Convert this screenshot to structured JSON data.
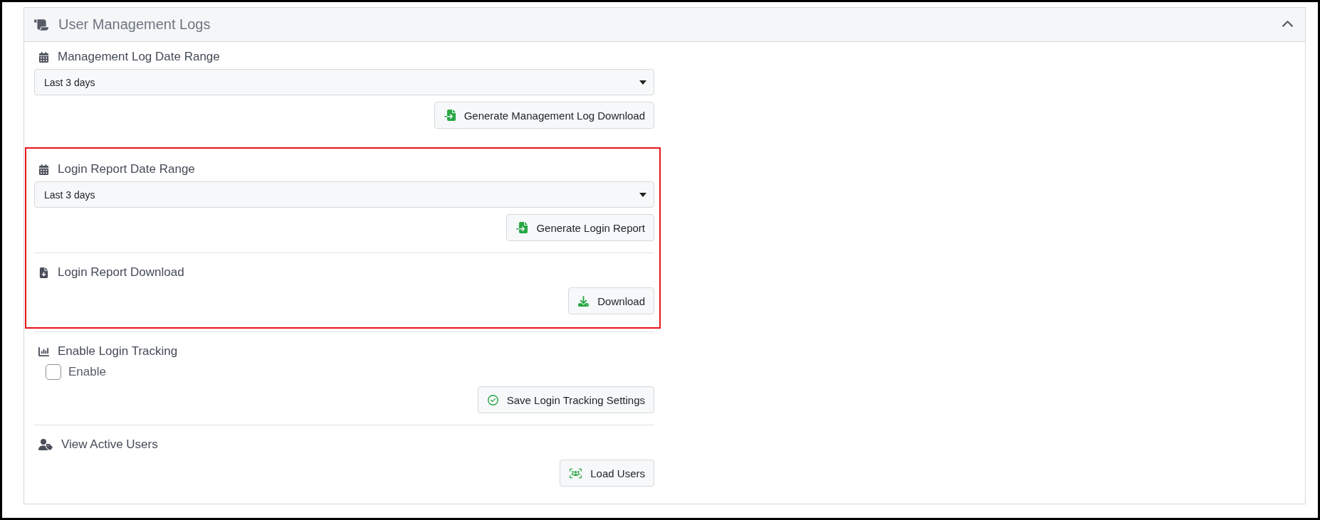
{
  "panel": {
    "title": "User Management Logs",
    "expanded": true
  },
  "groups": [
    {
      "highlighted": false,
      "sections": [
        {
          "kind": "date-range",
          "title": "Management Log Date Range",
          "select": "Last 3 days",
          "button": "Generate Management Log Download"
        }
      ]
    },
    {
      "highlighted": true,
      "sections": [
        {
          "kind": "date-range",
          "title": "Login Report Date Range",
          "select": "Last 3 days",
          "button": "Generate Login Report"
        },
        {
          "kind": "file-download",
          "title": "Login Report Download",
          "button": "Download"
        }
      ]
    },
    {
      "highlighted": false,
      "sections": [
        {
          "kind": "toggle",
          "title": "Enable Login Tracking",
          "checkbox": {
            "label": "Enable",
            "checked": false
          },
          "button": "Save Login Tracking Settings"
        },
        {
          "kind": "user-list",
          "title": "View Active Users",
          "button": "Load Users"
        }
      ]
    }
  ]
}
